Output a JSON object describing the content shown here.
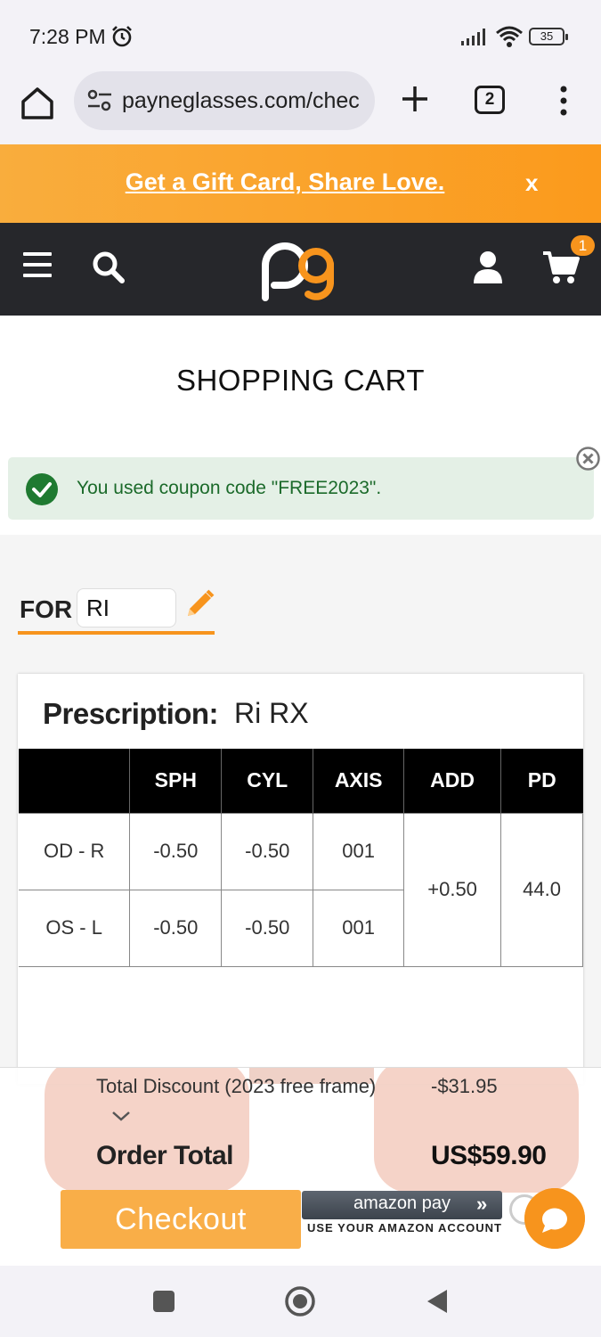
{
  "status_bar": {
    "time": "7:28 PM",
    "battery": "35"
  },
  "browser": {
    "url": "payneglasses.com/chec",
    "tab_count": "2"
  },
  "promo": {
    "text": "Get a Gift Card, Share Love.",
    "close": "x"
  },
  "header": {
    "cart_count": "1",
    "logo_alt": "pg logo"
  },
  "page": {
    "title": "SHOPPING CART"
  },
  "alert": {
    "message": "You used coupon code \"FREE2023\"."
  },
  "for_section": {
    "label": "FOR",
    "name_value": "RI"
  },
  "prescription": {
    "label": "Prescription:",
    "name": "Ri RX",
    "columns": [
      "",
      "SPH",
      "CYL",
      "AXIS",
      "ADD",
      "PD"
    ],
    "rows": [
      {
        "eye": "OD - R",
        "sph": "-0.50",
        "cyl": "-0.50",
        "axis": "001"
      },
      {
        "eye": "OS - L",
        "sph": "-0.50",
        "cyl": "-0.50",
        "axis": "001"
      }
    ],
    "add": "+0.50",
    "pd": "44.0"
  },
  "summary": {
    "discount_label": "Total Discount (2023 free frame)",
    "discount_value": "-$31.95",
    "total_label": "Order Total",
    "total_value": "US$59.90",
    "checkout_label": "Checkout",
    "amazon_pay": "amazon pay",
    "amazon_arrows": "»",
    "amazon_sub": "USE YOUR AMAZON ACCOUNT"
  },
  "colors": {
    "accent": "#f7941d",
    "header_bg": "#26272b",
    "success": "#1b6a2a"
  }
}
